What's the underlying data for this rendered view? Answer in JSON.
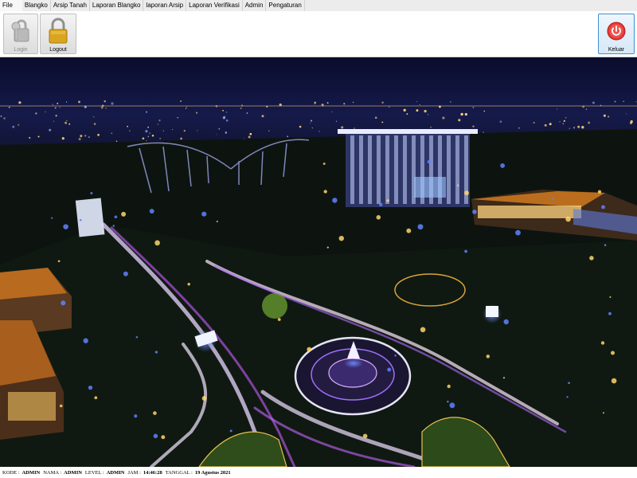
{
  "menubar": {
    "file": "File",
    "tabs": [
      {
        "label": "Blangko"
      },
      {
        "label": "Arsip Tanah"
      },
      {
        "label": "Laporan Blangko"
      },
      {
        "label": "laporan Arsip"
      },
      {
        "label": "Laporan Verifikasi"
      },
      {
        "label": "Admin"
      },
      {
        "label": "Pengaturan"
      }
    ]
  },
  "toolbar": {
    "login_label": "Login",
    "logout_label": "Logout",
    "exit_label": "Keluar"
  },
  "icons": {
    "login": "key-lock-icon",
    "logout": "padlock-icon",
    "exit": "power-icon"
  },
  "colors": {
    "exit_icon": "#e53935",
    "padlock": "#d4a01e",
    "accent_border": "#3f8fd2"
  },
  "status": {
    "kode_label": "KODE :",
    "kode_value": "ADMIN",
    "nama_label": "NAMA :",
    "nama_value": "ADMIN",
    "level_label": "LEVEL :",
    "level_value": "ADMIN",
    "jam_label": "JAM :",
    "jam_value": "14:46:28",
    "tanggal_label": "TANGGAL :",
    "tanggal_value": "19 Agustus 2021"
  }
}
